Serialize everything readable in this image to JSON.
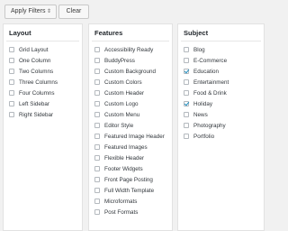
{
  "toolbar": {
    "apply_label": "Apply Filters",
    "apply_arrows": "⇕",
    "clear_label": "Clear"
  },
  "layout": {
    "title": "Layout",
    "items": [
      {
        "label": "Grid Layout",
        "checked": false
      },
      {
        "label": "One Column",
        "checked": false
      },
      {
        "label": "Two Columns",
        "checked": false
      },
      {
        "label": "Three Columns",
        "checked": false
      },
      {
        "label": "Four Columns",
        "checked": false
      },
      {
        "label": "Left Sidebar",
        "checked": false
      },
      {
        "label": "Right Sidebar",
        "checked": false
      }
    ]
  },
  "features": {
    "title": "Features",
    "items": [
      {
        "label": "Accessibility Ready",
        "checked": false
      },
      {
        "label": "BuddyPress",
        "checked": false
      },
      {
        "label": "Custom Background",
        "checked": false
      },
      {
        "label": "Custom Colors",
        "checked": false
      },
      {
        "label": "Custom Header",
        "checked": false
      },
      {
        "label": "Custom Logo",
        "checked": false
      },
      {
        "label": "Custom Menu",
        "checked": false
      },
      {
        "label": "Editor Style",
        "checked": false
      },
      {
        "label": "Featured Image Header",
        "checked": false
      },
      {
        "label": "Featured Images",
        "checked": false
      },
      {
        "label": "Flexible Header",
        "checked": false
      },
      {
        "label": "Footer Widgets",
        "checked": false
      },
      {
        "label": "Front Page Posting",
        "checked": false
      },
      {
        "label": "Full Width Template",
        "checked": false
      },
      {
        "label": "Microformats",
        "checked": false
      },
      {
        "label": "Post Formats",
        "checked": false
      }
    ]
  },
  "subject": {
    "title": "Subject",
    "items": [
      {
        "label": "Blog",
        "checked": false
      },
      {
        "label": "E-Commerce",
        "checked": false
      },
      {
        "label": "Education",
        "checked": true
      },
      {
        "label": "Entertainment",
        "checked": false
      },
      {
        "label": "Food & Drink",
        "checked": false
      },
      {
        "label": "Holiday",
        "checked": true
      },
      {
        "label": "News",
        "checked": false
      },
      {
        "label": "Photography",
        "checked": false
      },
      {
        "label": "Portfolio",
        "checked": false
      }
    ]
  },
  "colors": {
    "background": "#f1f1f1",
    "panel": "#ffffff",
    "checkmark": "#1e8cbe"
  }
}
